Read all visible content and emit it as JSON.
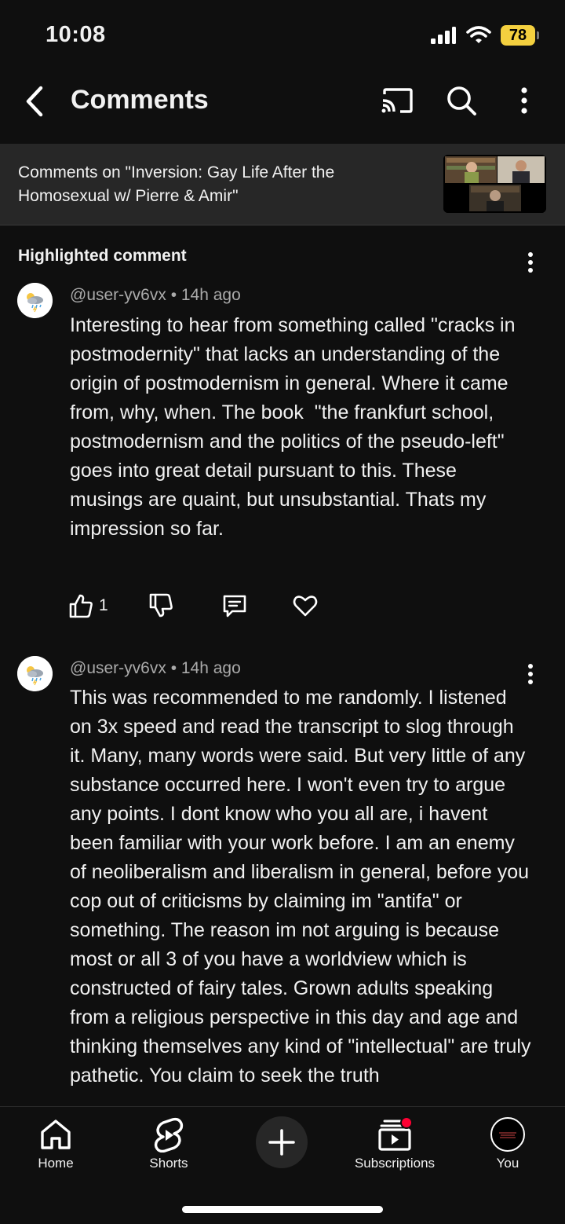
{
  "status_bar": {
    "time": "10:08",
    "battery": "78"
  },
  "header": {
    "title": "Comments"
  },
  "video": {
    "title": "Comments on \"Inversion: Gay Life After the Homosexual w/ Pierre & Amir\""
  },
  "highlighted": {
    "label": "Highlighted comment",
    "comment": {
      "author": "@user-yv6vx",
      "time": "14h ago",
      "text": "Interesting to hear from something called \"cracks in postmodernity\" that lacks an understanding of the origin of postmodernism in general. Where it came from, why, when. The book  \"the frankfurt school, postmodernism and the politics of the pseudo-left\" goes into great detail pursuant to this. These musings are quaint, but unsubstantial. Thats my impression so far.",
      "likes": "1"
    }
  },
  "comment2": {
    "author": "@user-yv6vx",
    "time": "14h ago",
    "text": "This was recommended to me randomly. I listened on 3x speed and read the transcript to slog through it. Many, many words were said. But very little of any substance occurred here. I won't even try to argue any points. I dont know who you all are, i havent been familiar with your work before. I am an enemy of neoliberalism and liberalism in general, before you cop out of criticisms by claiming im \"antifa\" or something. The reason im not arguing is because most or all 3 of you have a worldview which is constructed of fairy tales. Grown adults speaking from a religious perspective in this day and age and thinking themselves any kind of \"intellectual\" are truly pathetic. You claim to seek the truth"
  },
  "nav": {
    "home": "Home",
    "shorts": "Shorts",
    "subscriptions": "Subscriptions",
    "you": "You"
  },
  "colors": {
    "background": "#0f0f0f",
    "banner": "#272727",
    "notification": "#ff0033",
    "battery": "#f4d03f"
  }
}
